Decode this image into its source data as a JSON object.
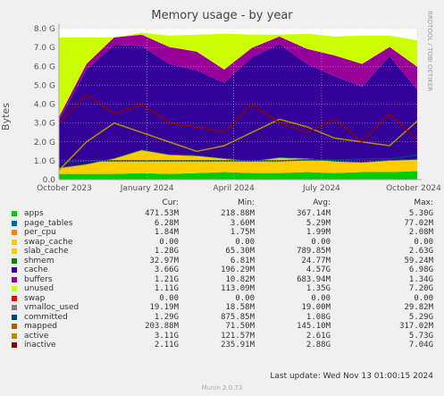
{
  "title": "Memory usage - by year",
  "ylabel": "Bytes",
  "side_text": "RRDTOOL / TOBI OETIKER",
  "colors": {
    "background": "#f0f0f0",
    "plot_bg": "#ffffff",
    "grid": "#e8b4b4",
    "axis": "#aaaaaa"
  },
  "chart_data": {
    "type": "area",
    "title": "Memory usage - by year",
    "ylabel": "Bytes",
    "ylim": [
      0,
      8.0
    ],
    "y_unit": "G",
    "y_ticks": [
      "0.0",
      "1.0 G",
      "2.0 G",
      "3.0 G",
      "4.0 G",
      "5.0 G",
      "6.0 G",
      "7.0 G",
      "8.0 G"
    ],
    "x_ticks": [
      "October 2023",
      "January 2024",
      "April 2024",
      "July 2024",
      "October 2024"
    ],
    "grid": true,
    "notes": "Stacked area: apps, page_tables, per_cpu, swap_cache, slab_cache, shmem, cache, buffers, unused, swap; lines: vmalloc_used, committed, mapped, active, inactive. Approximate monthly values in GB.",
    "months": [
      "2023-10",
      "2023-11",
      "2023-12",
      "2024-01",
      "2024-02",
      "2024-03",
      "2024-04",
      "2024-05",
      "2024-06",
      "2024-07",
      "2024-08",
      "2024-09",
      "2024-10",
      "2024-11"
    ],
    "series": [
      {
        "name": "apps",
        "color": "#00cc00",
        "stacked": true,
        "values": [
          0.3,
          0.3,
          0.3,
          0.35,
          0.3,
          0.35,
          0.4,
          0.35,
          0.35,
          0.4,
          0.35,
          0.4,
          0.4,
          0.45
        ]
      },
      {
        "name": "slab_cache",
        "color": "#ffcc00",
        "stacked": true,
        "values": [
          0.3,
          0.5,
          0.8,
          1.2,
          1.0,
          0.9,
          0.7,
          0.6,
          0.8,
          0.7,
          0.6,
          0.5,
          0.6,
          0.6
        ]
      },
      {
        "name": "shmem",
        "color": "#008f00",
        "stacked": true,
        "values": [
          0.03,
          0.03,
          0.03,
          0.03,
          0.03,
          0.03,
          0.03,
          0.03,
          0.03,
          0.03,
          0.03,
          0.03,
          0.03,
          0.03
        ]
      },
      {
        "name": "cache",
        "color": "#330099",
        "stacked": true,
        "values": [
          2.5,
          5.0,
          6.0,
          5.5,
          4.8,
          4.5,
          4.0,
          5.5,
          6.0,
          5.0,
          4.5,
          4.0,
          5.5,
          3.7
        ]
      },
      {
        "name": "buffers",
        "color": "#990099",
        "stacked": true,
        "values": [
          0.2,
          0.3,
          0.4,
          0.6,
          0.9,
          1.0,
          0.7,
          0.5,
          0.4,
          0.8,
          1.1,
          1.2,
          0.5,
          1.2
        ]
      },
      {
        "name": "unused",
        "color": "#ccff00",
        "stacked": true,
        "values": [
          4.2,
          1.4,
          0.0,
          0.1,
          0.6,
          0.9,
          1.9,
          0.7,
          0.1,
          0.8,
          1.0,
          1.5,
          0.6,
          1.4
        ]
      },
      {
        "name": "committed",
        "color": "#00457f",
        "stacked": false,
        "values": [
          0.9,
          1.0,
          1.0,
          1.0,
          1.0,
          1.0,
          1.0,
          1.0,
          1.0,
          1.05,
          1.05,
          1.1,
          1.1,
          1.3
        ]
      },
      {
        "name": "active",
        "color": "#b38f00",
        "stacked": false,
        "values": [
          0.5,
          2.0,
          3.0,
          2.5,
          2.0,
          1.5,
          1.8,
          2.5,
          3.2,
          2.8,
          2.2,
          2.0,
          1.8,
          3.1
        ]
      },
      {
        "name": "inactive",
        "color": "#8f0000",
        "stacked": false,
        "values": [
          3.0,
          4.5,
          3.5,
          4.0,
          3.0,
          2.8,
          2.5,
          4.0,
          3.0,
          2.5,
          3.2,
          2.0,
          3.5,
          2.1
        ]
      }
    ]
  },
  "legend": {
    "headers": {
      "cur": "Cur:",
      "min": "Min:",
      "avg": "Avg:",
      "max": "Max:"
    },
    "rows": [
      {
        "name": "apps",
        "color": "#00cc00",
        "cur": "471.53M",
        "min": "218.88M",
        "avg": "367.14M",
        "max": "5.30G"
      },
      {
        "name": "page_tables",
        "color": "#0066b3",
        "cur": "6.28M",
        "min": "3.60M",
        "avg": "5.29M",
        "max": "77.02M"
      },
      {
        "name": "per_cpu",
        "color": "#ff8000",
        "cur": "1.84M",
        "min": "1.75M",
        "avg": "1.99M",
        "max": "2.08M"
      },
      {
        "name": "swap_cache",
        "color": "#ffcc00",
        "cur": "0.00",
        "min": "0.00",
        "avg": "0.00",
        "max": "0.00"
      },
      {
        "name": "slab_cache",
        "color": "#ffcc00",
        "cur": "1.28G",
        "min": "65.30M",
        "avg": "789.85M",
        "max": "2.63G"
      },
      {
        "name": "shmem",
        "color": "#008f00",
        "cur": "32.97M",
        "min": "6.81M",
        "avg": "24.77M",
        "max": "59.24M"
      },
      {
        "name": "cache",
        "color": "#330099",
        "cur": "3.66G",
        "min": "196.29M",
        "avg": "4.57G",
        "max": "6.98G"
      },
      {
        "name": "buffers",
        "color": "#990099",
        "cur": "1.21G",
        "min": "10.82M",
        "avg": "683.94M",
        "max": "1.34G"
      },
      {
        "name": "unused",
        "color": "#ccff00",
        "cur": "1.11G",
        "min": "113.09M",
        "avg": "1.35G",
        "max": "7.20G"
      },
      {
        "name": "swap",
        "color": "#ff0000",
        "cur": "0.00",
        "min": "0.00",
        "avg": "0.00",
        "max": "0.00"
      },
      {
        "name": "vmalloc_used",
        "color": "#808080",
        "cur": "19.19M",
        "min": "18.58M",
        "avg": "19.00M",
        "max": "29.82M"
      },
      {
        "name": "committed",
        "color": "#00457f",
        "cur": "1.29G",
        "min": "875.85M",
        "avg": "1.08G",
        "max": "5.29G"
      },
      {
        "name": "mapped",
        "color": "#b35a00",
        "cur": "203.88M",
        "min": "71.50M",
        "avg": "145.10M",
        "max": "317.02M"
      },
      {
        "name": "active",
        "color": "#b38f00",
        "cur": "3.11G",
        "min": "121.57M",
        "avg": "2.61G",
        "max": "5.73G"
      },
      {
        "name": "inactive",
        "color": "#8f0000",
        "cur": "2.11G",
        "min": "235.91M",
        "avg": "2.88G",
        "max": "7.04G"
      }
    ]
  },
  "last_update": "Last update: Wed Nov 13 01:00:15 2024",
  "footer": "Munin 2.0.73"
}
